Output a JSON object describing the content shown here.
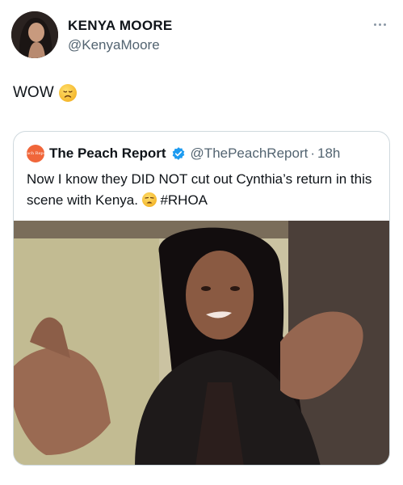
{
  "author": {
    "name": "KENYA MOORE",
    "handle": "@KenyaMoore"
  },
  "tweet": {
    "text": "WOW",
    "emoji": "disappointed-face-emoji"
  },
  "quote": {
    "avatar_text": "Peach Report",
    "name": "The Peach Report",
    "handle": "@ThePeachReport",
    "separator": "·",
    "time": "18h",
    "text_part1": "Now I know they DID NOT cut out Cynthia’s return in this scene with Kenya.",
    "emoji": "weary-face-emoji",
    "hashtag": "#RHOA",
    "verified_color": "#1d9bf0"
  },
  "media": {
    "description_icon": "video-still-image"
  },
  "colors": {
    "text": "#0f1419",
    "secondary": "#536471",
    "border": "#cfd9de",
    "peach": "#f0663a"
  }
}
